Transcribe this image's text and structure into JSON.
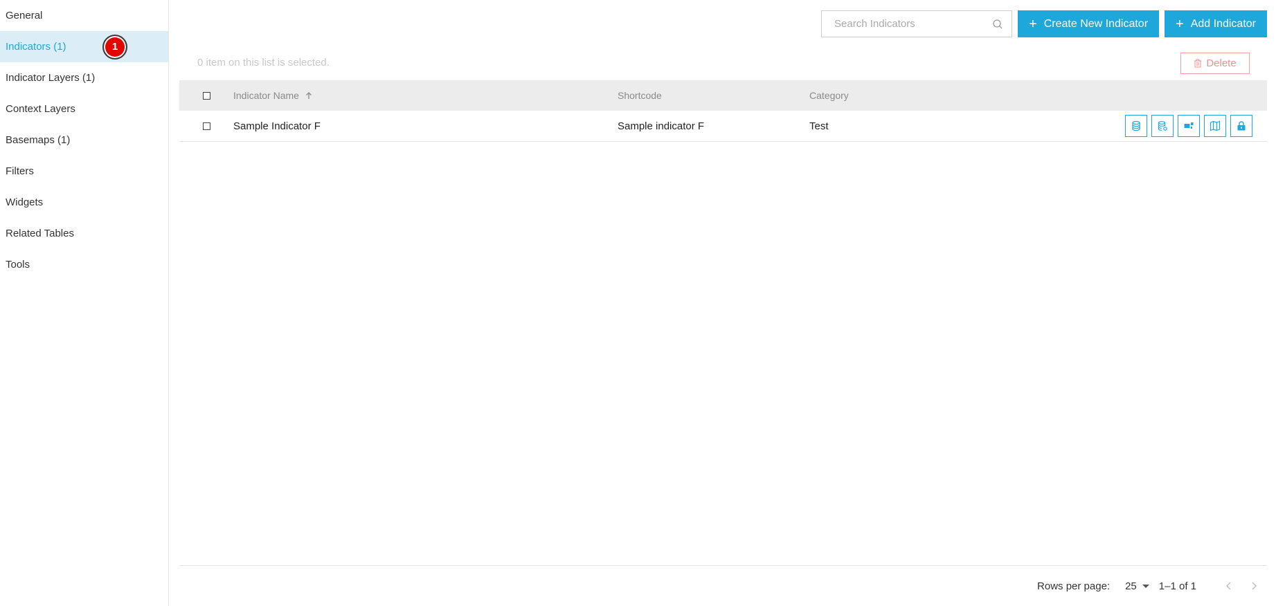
{
  "sidebar": {
    "items": [
      {
        "label": "General"
      },
      {
        "label": "Indicators (1)",
        "active": true,
        "badge": "1"
      },
      {
        "label": "Indicator Layers (1)"
      },
      {
        "label": "Context Layers"
      },
      {
        "label": "Basemaps (1)"
      },
      {
        "label": "Filters"
      },
      {
        "label": "Widgets"
      },
      {
        "label": "Related Tables"
      },
      {
        "label": "Tools"
      }
    ]
  },
  "toolbar": {
    "search_placeholder": "Search Indicators",
    "create_label": "Create New Indicator",
    "add_label": "Add Indicator"
  },
  "selection_info": "0 item on this list is selected.",
  "delete_label": "Delete",
  "table": {
    "headers": {
      "name": "Indicator Name",
      "shortcode": "Shortcode",
      "category": "Category"
    },
    "rows": [
      {
        "name": "Sample Indicator F",
        "shortcode": "Sample indicator F",
        "category": "Test",
        "actions": [
          "database-icon",
          "database-settings-icon",
          "value-type-icon",
          "map-icon",
          "lock-icon"
        ]
      }
    ]
  },
  "footer": {
    "rows_per_page_label": "Rows per page:",
    "rows_per_page_value": "25",
    "range": "1–1 of 1"
  },
  "colors": {
    "accent": "#1ea7db",
    "active_bg": "#dbeef8",
    "badge": "#e10600",
    "delete": "#f08f8f"
  }
}
